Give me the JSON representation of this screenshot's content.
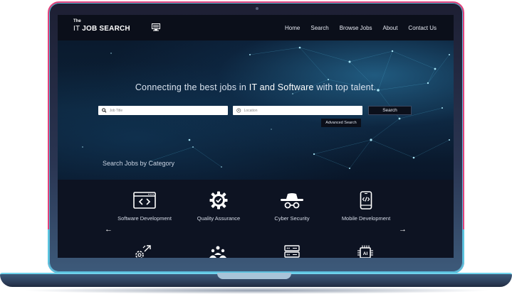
{
  "logo": {
    "the": "The",
    "it": "IT",
    "job_search": "JOB SEARCH"
  },
  "nav": {
    "items": [
      {
        "label": "Home"
      },
      {
        "label": "Search"
      },
      {
        "label": "Browse Jobs"
      },
      {
        "label": "About"
      },
      {
        "label": "Contact Us"
      }
    ]
  },
  "hero": {
    "tagline_start": "Connecting the best jobs in ",
    "tagline_bold": "IT and Software",
    "tagline_end": " with top talent."
  },
  "search": {
    "job_title_placeholder": "Job Title",
    "location_placeholder": "Location",
    "search_label": "Search",
    "advanced_label": "Advanced Search"
  },
  "categories": {
    "heading": "Search Jobs by Category",
    "items": [
      {
        "label": "Software Development",
        "icon": "code-window-icon"
      },
      {
        "label": "Quality Assurance",
        "icon": "gear-check-icon"
      },
      {
        "label": "Cyber Security",
        "icon": "spy-hat-icon"
      },
      {
        "label": "Mobile Development",
        "icon": "mobile-phone-icon"
      }
    ],
    "row2_icons": [
      "gear-arrows-icon",
      "team-icon",
      "server-icon",
      "ai-chip-icon"
    ],
    "prev": "←",
    "next": "→"
  },
  "colors": {
    "background": "#0d1322",
    "navbar": "#0b0f1a",
    "frame_accent_pink": "#e2407a",
    "frame_accent_cyan": "#5bc4de"
  }
}
